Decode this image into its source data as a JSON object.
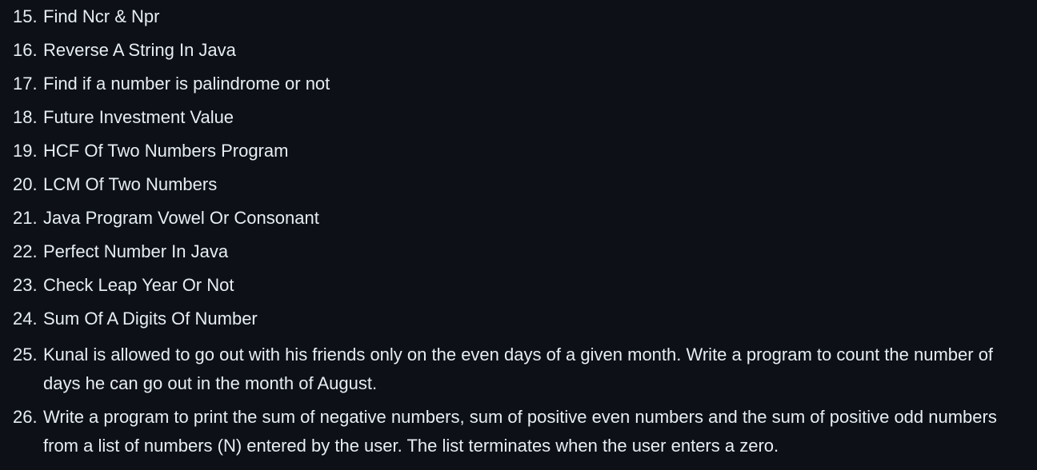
{
  "list": {
    "items": [
      {
        "number": "15.",
        "text": "Find Ncr & Npr"
      },
      {
        "number": "16.",
        "text": "Reverse A String In Java"
      },
      {
        "number": "17.",
        "text": "Find if a number is palindrome or not"
      },
      {
        "number": "18.",
        "text": "Future Investment Value"
      },
      {
        "number": "19.",
        "text": "HCF Of Two Numbers Program"
      },
      {
        "number": "20.",
        "text": "LCM Of Two Numbers"
      },
      {
        "number": "21.",
        "text": "Java Program Vowel Or Consonant"
      },
      {
        "number": "22.",
        "text": "Perfect Number In Java"
      },
      {
        "number": "23.",
        "text": "Check Leap Year Or Not"
      },
      {
        "number": "24.",
        "text": "Sum Of A Digits Of Number"
      },
      {
        "number": "25.",
        "text": "Kunal is allowed to go out with his friends only on the even days of a given month. Write a program to count the number of days he can go out in the month of August."
      },
      {
        "number": "26.",
        "text": "Write a program to print the sum of negative numbers, sum of positive even numbers and the sum of positive odd numbers from a list of numbers (N) entered by the user. The list terminates when the user enters a zero."
      }
    ]
  },
  "colors": {
    "background": "#0d1117",
    "text": "#e6edf3"
  }
}
